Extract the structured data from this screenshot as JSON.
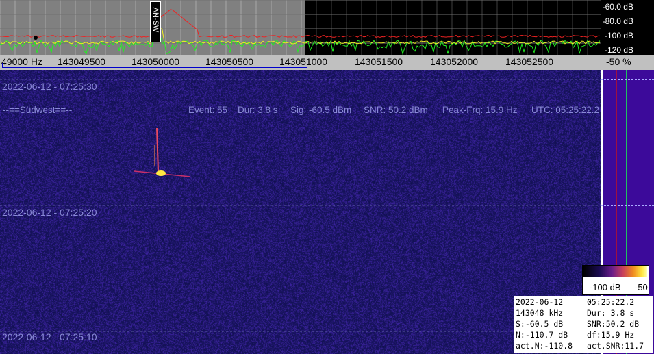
{
  "spectrum": {
    "db_labels": [
      "-60.0 dB",
      "-80.0 dB",
      "-100 dB",
      "-120 dB"
    ],
    "marker_label": "AN-SW"
  },
  "freq_axis": {
    "labels": [
      "49000 Hz",
      "143049500",
      "143050000",
      "143050500",
      "143051000",
      "143051500",
      "143052000",
      "143052500"
    ]
  },
  "percent": "-50 %",
  "waterfall": {
    "timestamps": [
      "2022-06-12 - 07:25:30",
      "2022-06-12 - 07:25:20",
      "2022-06-12 - 07:25:10"
    ],
    "event": {
      "station": "--==Südwest==--",
      "event": "Event: 55",
      "duration": "Dur: 3.8 s",
      "signal": "Sig: -60.5 dBm",
      "snr": "SNR: 50.2 dBm",
      "peak": "Peak-Frq: 15.9 Hz",
      "utc": "UTC: 05:25:22.2"
    }
  },
  "colorbar": {
    "min_label": "-100 dB",
    "max_label": "-50"
  },
  "info": {
    "date": "2022-06-12",
    "time": "05:25:22.2",
    "freq": "143048 kHz",
    "dur": "Dur:  3.8 s",
    "s": "S:-60.5 dB",
    "snr": "SNR:50.2 dB",
    "n": "N:-110.7 dB",
    "df": "df:15.9 Hz",
    "actn": "act.N:-110.8",
    "actsnr": "act.SNR:11.7"
  },
  "colors": {
    "waterfall_bg": "#1a1a6e",
    "spectrum_green": "#22ee22",
    "spectrum_red": "#ee2222",
    "sidebar": "#3c0a9a"
  }
}
